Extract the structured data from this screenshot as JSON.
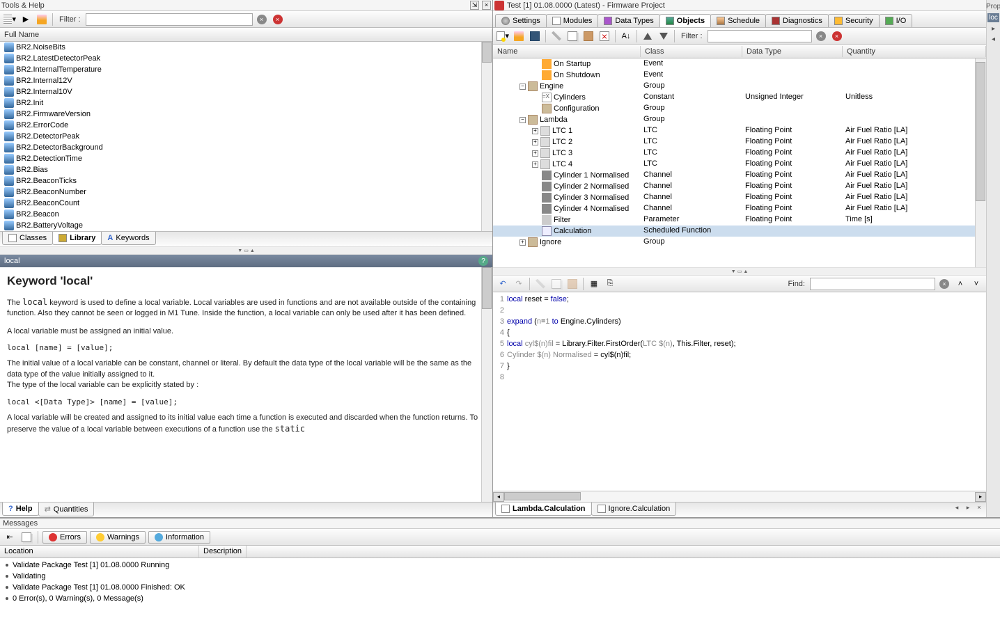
{
  "left": {
    "title": "Tools & Help",
    "filter_label": "Filter :",
    "filter_placeholder": "",
    "full_name_header": "Full Name",
    "library_items": [
      "BR2.BatteryVoltage",
      "BR2.Beacon",
      "BR2.BeaconCount",
      "BR2.BeaconNumber",
      "BR2.BeaconTicks",
      "BR2.Bias",
      "BR2.DetectionTime",
      "BR2.DetectorBackground",
      "BR2.DetectorPeak",
      "BR2.ErrorCode",
      "BR2.FirmwareVersion",
      "BR2.Init",
      "BR2.Internal10V",
      "BR2.Internal12V",
      "BR2.InternalTemperature",
      "BR2.LatestDetectorPeak",
      "BR2.NoiseBits"
    ],
    "tabs": {
      "classes": "Classes",
      "library": "Library",
      "keywords": "Keywords"
    },
    "help_topic": "local",
    "help_heading": "Keyword 'local'",
    "help_p1a": "The ",
    "help_p1_code": "local",
    "help_p1b": " keyword is used to define a local variable. Local variables are used in functions and are not available outside of the containing function. Also they cannot be seen or logged in M1 Tune. Inside the function, a local variable can only be used after it has been defined.",
    "help_p2": "A local variable must be assigned an initial value.",
    "help_code1": "local [name] = [value];",
    "help_p3": "The initial value of a local variable can be constant, channel or literal. By default the data type of the local variable will be the same as the data type of the value initially assigned to it.",
    "help_p3b": "The type of the local variable can be explicitly stated by :",
    "help_code2": "local <[Data Type]> [name] = [value];",
    "help_p4a": "A local variable will be created and assigned to its initial value each time a function is executed and discarded when the function returns. To preserve the value of a local variable between executions of a function use the ",
    "help_p4_code": "static",
    "bottom_tabs": {
      "help": "Help",
      "quantities": "Quantities"
    }
  },
  "right": {
    "window_title": "Test [1] 01.08.0000 (Latest) - Firmware Project",
    "tabs": {
      "settings": "Settings",
      "modules": "Modules",
      "datatypes": "Data Types",
      "objects": "Objects",
      "schedule": "Schedule",
      "diagnostics": "Diagnostics",
      "security": "Security",
      "io": "I/O"
    },
    "filter_label": "Filter :",
    "columns": {
      "name": "Name",
      "class": "Class",
      "datatype": "Data Type",
      "quantity": "Quantity"
    },
    "tree": [
      {
        "indent": 2,
        "exp": "",
        "icon": "event",
        "name": "On Startup",
        "class": "Event",
        "type": "",
        "qty": ""
      },
      {
        "indent": 2,
        "exp": "",
        "icon": "event",
        "name": "On Shutdown",
        "class": "Event",
        "type": "",
        "qty": ""
      },
      {
        "indent": 1,
        "exp": "-",
        "icon": "group",
        "name": "Engine",
        "class": "Group",
        "type": "",
        "qty": ""
      },
      {
        "indent": 2,
        "exp": "",
        "icon": "const",
        "name": "Cylinders",
        "class": "Constant",
        "type": "Unsigned Integer",
        "qty": "Unitless"
      },
      {
        "indent": 2,
        "exp": "",
        "icon": "group",
        "name": "Configuration",
        "class": "Group",
        "type": "",
        "qty": ""
      },
      {
        "indent": 1,
        "exp": "-",
        "icon": "group",
        "name": "Lambda",
        "class": "Group",
        "type": "",
        "qty": ""
      },
      {
        "indent": 2,
        "exp": "+",
        "icon": "ltc",
        "name": "LTC 1",
        "class": "LTC",
        "type": "Floating Point",
        "qty": "Air Fuel Ratio [LA]"
      },
      {
        "indent": 2,
        "exp": "+",
        "icon": "ltc",
        "name": "LTC 2",
        "class": "LTC",
        "type": "Floating Point",
        "qty": "Air Fuel Ratio [LA]"
      },
      {
        "indent": 2,
        "exp": "+",
        "icon": "ltc",
        "name": "LTC 3",
        "class": "LTC",
        "type": "Floating Point",
        "qty": "Air Fuel Ratio [LA]"
      },
      {
        "indent": 2,
        "exp": "+",
        "icon": "ltc",
        "name": "LTC 4",
        "class": "LTC",
        "type": "Floating Point",
        "qty": "Air Fuel Ratio [LA]"
      },
      {
        "indent": 2,
        "exp": "",
        "icon": "chan",
        "name": "Cylinder 1 Normalised",
        "class": "Channel",
        "type": "Floating Point",
        "qty": "Air Fuel Ratio [LA]"
      },
      {
        "indent": 2,
        "exp": "",
        "icon": "chan",
        "name": "Cylinder 2 Normalised",
        "class": "Channel",
        "type": "Floating Point",
        "qty": "Air Fuel Ratio [LA]"
      },
      {
        "indent": 2,
        "exp": "",
        "icon": "chan",
        "name": "Cylinder 3 Normalised",
        "class": "Channel",
        "type": "Floating Point",
        "qty": "Air Fuel Ratio [LA]"
      },
      {
        "indent": 2,
        "exp": "",
        "icon": "chan",
        "name": "Cylinder 4 Normalised",
        "class": "Channel",
        "type": "Floating Point",
        "qty": "Air Fuel Ratio [LA]"
      },
      {
        "indent": 2,
        "exp": "",
        "icon": "param",
        "name": "Filter",
        "class": "Parameter",
        "type": "Floating Point",
        "qty": "Time [s]"
      },
      {
        "indent": 2,
        "exp": "",
        "icon": "func",
        "name": "Calculation",
        "class": "Scheduled Function",
        "type": "",
        "qty": "",
        "selected": true
      },
      {
        "indent": 1,
        "exp": "+",
        "icon": "group",
        "name": "Ignore",
        "class": "Group",
        "type": "",
        "qty": ""
      }
    ],
    "find_label": "Find:",
    "code": [
      {
        "n": 1,
        "html": "<span class='kw'>local</span> reset = <span class='lit'>false</span>;"
      },
      {
        "n": 2,
        "html": ""
      },
      {
        "n": 3,
        "html": "<span class='kw'>expand</span> (<span class='id'>n</span>=<span class='num'>1</span> <span class='kw'>to</span> Engine.Cylinders)"
      },
      {
        "n": 4,
        "html": "{"
      },
      {
        "n": 5,
        "html": "<span class='kw'>local</span> <span class='id'>cyl$(n)fil</span> = Library.Filter.FirstOrder(<span class='id'>LTC $(n)</span>, This.Filter, reset);"
      },
      {
        "n": 6,
        "html": "<span class='id'>Cylinder $(n) Normalised</span> = cyl$(n)fil;"
      },
      {
        "n": 7,
        "html": "}"
      },
      {
        "n": 8,
        "html": ""
      }
    ],
    "editor_tabs": {
      "t1": "Lambda.Calculation",
      "t2": "Ignore.Calculation"
    }
  },
  "side": {
    "prop": "Prop",
    "loc": "loc"
  },
  "messages": {
    "title": "Messages",
    "errors": "Errors",
    "warnings": "Warnings",
    "information": "Information",
    "cols": {
      "location": "Location",
      "description": "Description"
    },
    "rows": [
      "Validate Package Test [1] 01.08.0000 Running",
      "Validating",
      "Validate Package Test [1] 01.08.0000 Finished: OK",
      "0 Error(s), 0 Warning(s), 0 Message(s)"
    ]
  }
}
